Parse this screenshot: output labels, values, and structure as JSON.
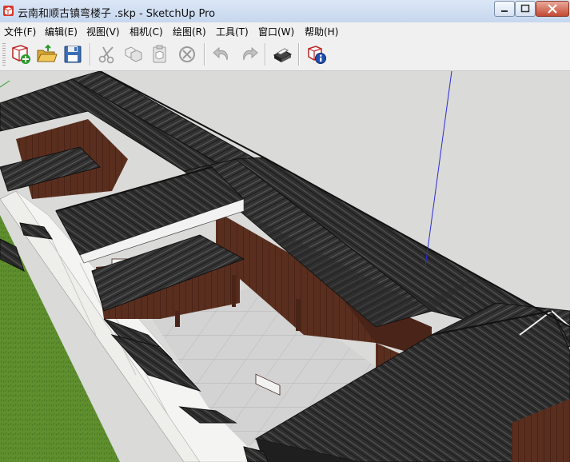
{
  "window": {
    "title": "云南和顺古镇弯楼子 .skp - SketchUp Pro",
    "app_icon": "sketchup-logo-icon",
    "controls": [
      "minimize-icon",
      "maximize-icon",
      "close-icon"
    ]
  },
  "menu": [
    {
      "label": "文件(F)"
    },
    {
      "label": "编辑(E)"
    },
    {
      "label": "视图(V)"
    },
    {
      "label": "相机(C)"
    },
    {
      "label": "绘图(R)"
    },
    {
      "label": "工具(T)"
    },
    {
      "label": "窗口(W)"
    },
    {
      "label": "帮助(H)"
    }
  ],
  "toolbar": {
    "tools": [
      {
        "icon": "new-file-icon",
        "enabled": true
      },
      {
        "icon": "open-folder-icon",
        "enabled": true
      },
      {
        "icon": "save-disk-icon",
        "enabled": true
      },
      {
        "icon": "cut-scissors-icon",
        "enabled": false
      },
      {
        "icon": "copy-icon",
        "enabled": false
      },
      {
        "icon": "paste-icon",
        "enabled": false
      },
      {
        "icon": "erase-icon",
        "enabled": false
      },
      {
        "icon": "undo-icon",
        "enabled": false
      },
      {
        "icon": "redo-icon",
        "enabled": false
      },
      {
        "icon": "print-icon",
        "enabled": true
      },
      {
        "icon": "model-info-icon",
        "enabled": true
      }
    ]
  },
  "viewport": {
    "content": "3d-model-courtyard-house",
    "colors": {
      "sky": "#dcdcdc",
      "ground": "#d6d6d4",
      "grass": "#5f8f2e",
      "roof": "#3a3a3a",
      "wood": "#5a2e1e",
      "wall": "#eeeeea",
      "axis_blue": "#2b2bd6"
    }
  }
}
